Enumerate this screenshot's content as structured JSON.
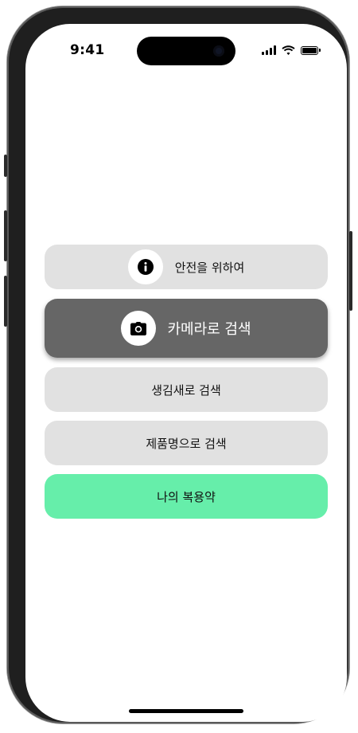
{
  "status_bar": {
    "time": "9:41",
    "icons": [
      "cellular-signal-icon",
      "wifi-icon",
      "battery-icon"
    ]
  },
  "menu": {
    "safety": {
      "label": "안전을 위하여",
      "icon": "info-icon"
    },
    "camera_search": {
      "label": "카메라로 검색",
      "icon": "camera-icon"
    },
    "shape_search": {
      "label": "생김새로 검색"
    },
    "product_search": {
      "label": "제품명으로 검색"
    },
    "my_medication": {
      "label": "나의 복용약"
    }
  },
  "colors": {
    "button_gray": "#e1e1e1",
    "button_active": "#666666",
    "button_accent": "#66eeaa"
  }
}
